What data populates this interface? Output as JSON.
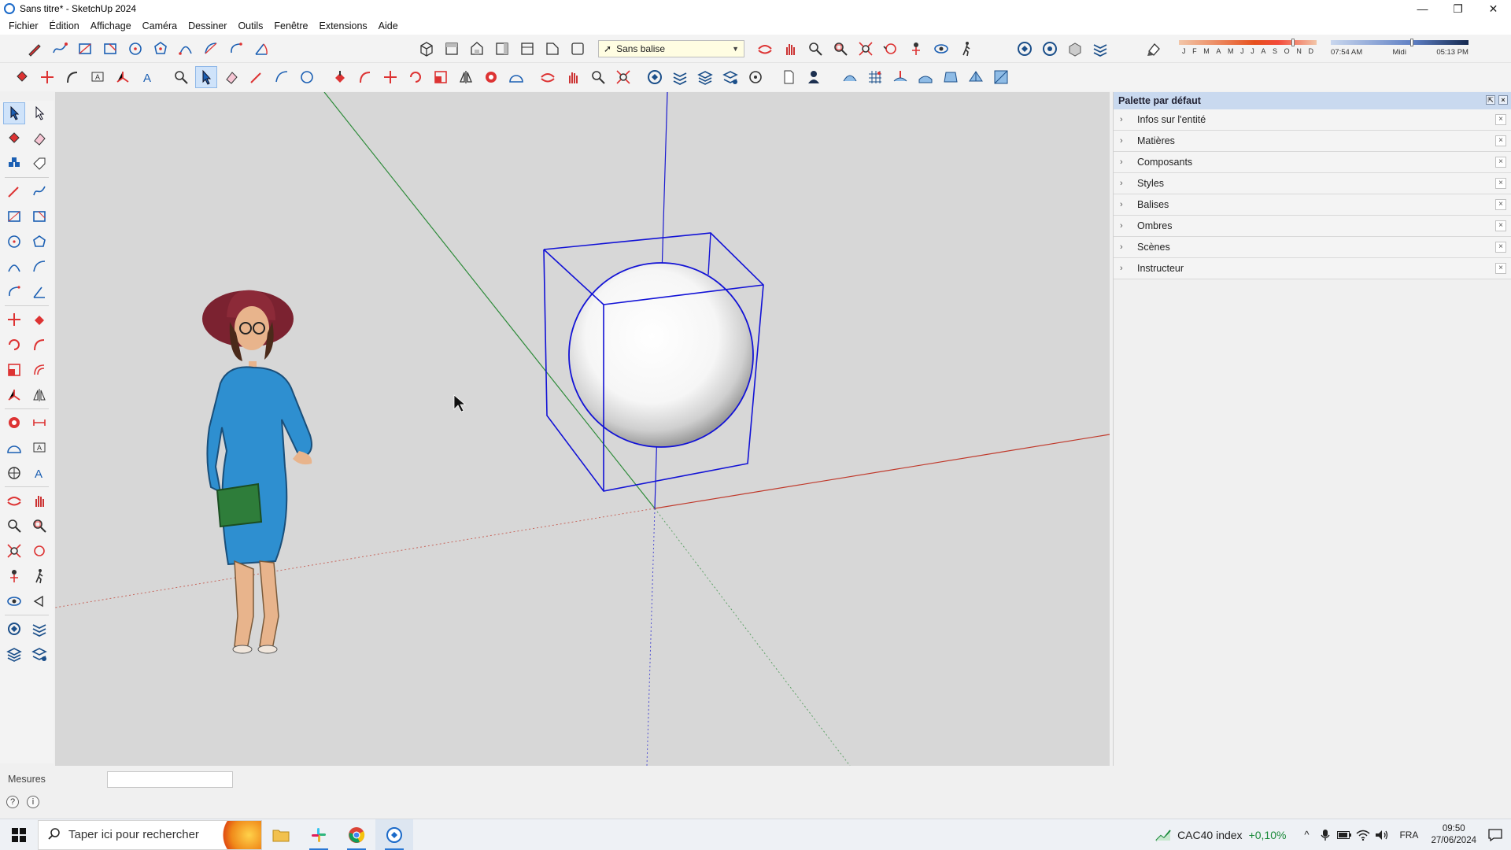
{
  "window": {
    "title": "Sans titre* - SketchUp 2024",
    "minimize": "—",
    "restore": "❐",
    "close": "✕"
  },
  "menu": [
    "Fichier",
    "Édition",
    "Affichage",
    "Caméra",
    "Dessiner",
    "Outils",
    "Fenêtre",
    "Extensions",
    "Aide"
  ],
  "toolbar": {
    "tag_selector": "Sans balise",
    "shadow_months": [
      "J",
      "F",
      "M",
      "A",
      "M",
      "J",
      "J",
      "A",
      "S",
      "O",
      "N",
      "D"
    ],
    "shadow_month_level": 0.83,
    "shadow_time_start": "07:54 AM",
    "shadow_time_mid": "Midi",
    "shadow_time_end": "05:13 PM",
    "shadow_time_level": 0.59
  },
  "tray": {
    "title": "Palette par défaut",
    "pin": "⇱",
    "close": "×",
    "panels": [
      {
        "label": "Infos sur l'entité"
      },
      {
        "label": "Matières"
      },
      {
        "label": "Composants"
      },
      {
        "label": "Styles"
      },
      {
        "label": "Balises"
      },
      {
        "label": "Ombres"
      },
      {
        "label": "Scènes"
      },
      {
        "label": "Instructeur"
      }
    ],
    "panel_chevron": "›",
    "panel_close": "×"
  },
  "status": {
    "measures_label": "Mesures",
    "measures_value": "",
    "help_icon": "?",
    "info_icon": "i"
  },
  "taskbar": {
    "search_placeholder": "Taper ici pour rechercher",
    "stock_name": "CAC40 index",
    "stock_change": "+0,10%",
    "language": "FRA",
    "time": "09:50",
    "date": "27/06/2024",
    "chevron_up": "^"
  },
  "colors": {
    "axis_red": "#c0392b",
    "axis_green": "#2e8b3a",
    "axis_blue": "#1a1ad0",
    "selection_blue": "#1212d6",
    "viewport_bg": "#d7d7d7",
    "tray_header": "#c9d9ef"
  }
}
